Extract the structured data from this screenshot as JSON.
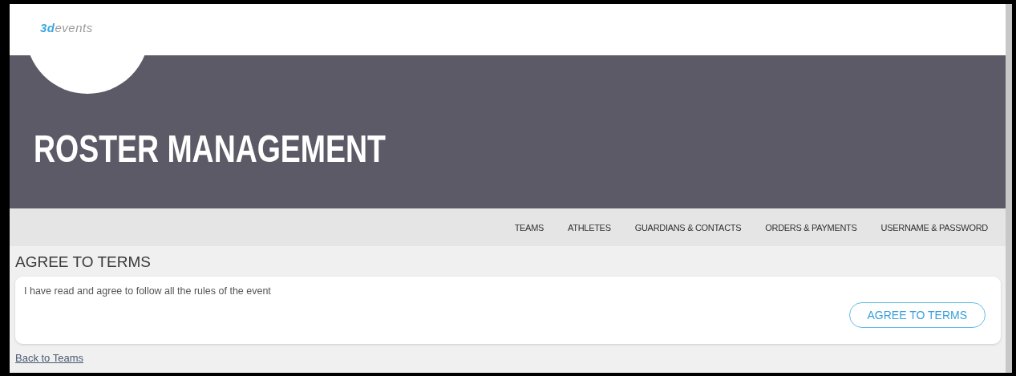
{
  "logo": {
    "prefix": "3d",
    "suffix": "events"
  },
  "banner": {
    "title": "ROSTER MANAGEMENT"
  },
  "nav": [
    {
      "label": "TEAMS"
    },
    {
      "label": "ATHLETES"
    },
    {
      "label": "GUARDIANS & CONTACTS"
    },
    {
      "label": "ORDERS & PAYMENTS"
    },
    {
      "label": "USERNAME & PASSWORD"
    }
  ],
  "section": {
    "heading": "AGREE TO TERMS",
    "text": "I have read and agree to follow all the rules of the event",
    "button": "AGREE TO TERMS"
  },
  "back_link": "Back to Teams"
}
